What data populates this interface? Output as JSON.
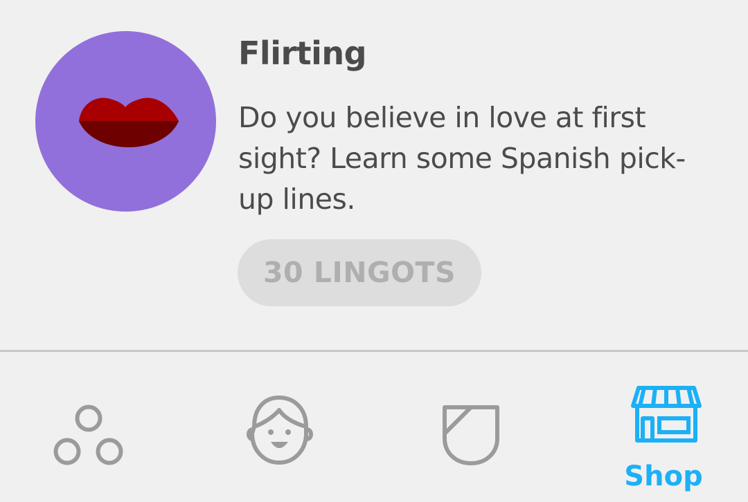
{
  "item": {
    "title": "Flirting",
    "description": "Do you believe in love at first sight? Learn some Spanish pick-up lines.",
    "price_label": "30 LINGOTS",
    "icon": "lips-icon",
    "icon_bg_color": "#9270db"
  },
  "tabs": [
    {
      "name": "learn",
      "icon": "circles-icon",
      "label": "",
      "active": false
    },
    {
      "name": "profile",
      "icon": "face-icon",
      "label": "",
      "active": false
    },
    {
      "name": "league",
      "icon": "shield-icon",
      "label": "",
      "active": false
    },
    {
      "name": "shop",
      "icon": "storefront-icon",
      "label": "Shop",
      "active": true
    }
  ],
  "colors": {
    "background": "#f0f0f0",
    "text": "#4b4b4b",
    "accent": "#1cb0f6",
    "inactive_icon": "#9b9b9b",
    "disabled_button_bg": "#dddddd",
    "disabled_button_text": "#afafaf"
  }
}
